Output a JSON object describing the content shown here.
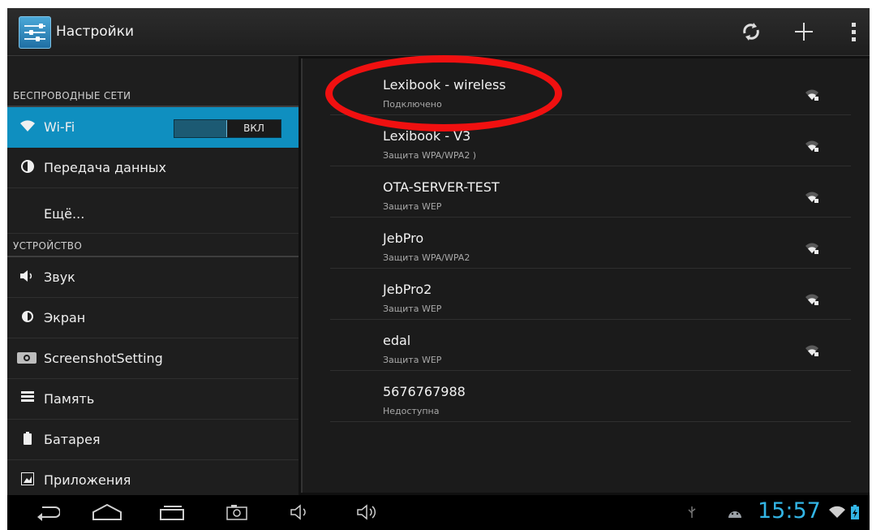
{
  "actionbar": {
    "title": "Настройки",
    "app_icon": "settings-sliders-icon",
    "sync_icon": "sync-icon",
    "add_icon": "plus-icon",
    "overflow_icon": "overflow-menu-icon"
  },
  "sidebar": {
    "section_wireless": "БЕСПРОВОДНЫЕ СЕТИ",
    "section_device": "УСТРОЙСТВО",
    "wifi": {
      "label": "Wi-Fi",
      "toggle_state": "ВКЛ",
      "icon": "wifi-icon"
    },
    "items": [
      {
        "label": "Передача данных",
        "icon": "data-usage-icon"
      },
      {
        "label": "Ещё...",
        "icon": ""
      },
      {
        "label": "Звук",
        "icon": "speaker-icon"
      },
      {
        "label": "Экран",
        "icon": "brightness-icon"
      },
      {
        "label": "ScreenshotSetting",
        "icon": "camera-icon"
      },
      {
        "label": "Память",
        "icon": "storage-icon"
      },
      {
        "label": "Батарея",
        "icon": "battery-icon"
      },
      {
        "label": "Приложения",
        "icon": "apps-icon"
      }
    ]
  },
  "networks": [
    {
      "ssid": "Lexibook - wireless",
      "status": "Подключено",
      "signal": true
    },
    {
      "ssid": "Lexibook - V3",
      "status": "Защита WPA/WPA2 )",
      "signal": true
    },
    {
      "ssid": "OTA-SERVER-TEST",
      "status": "Защита WEP",
      "signal": true
    },
    {
      "ssid": "JebPro",
      "status": "Защита WPA/WPA2",
      "signal": true
    },
    {
      "ssid": "JebPro2",
      "status": "Защита WEP",
      "signal": true
    },
    {
      "ssid": "edal",
      "status": "Защита WEP",
      "signal": true
    },
    {
      "ssid": "5676767988",
      "status": "Недоступна",
      "signal": false
    }
  ],
  "statusbar": {
    "time": "15:57",
    "accent": "#33b5e5",
    "icons": [
      "back-icon",
      "home-icon",
      "recent-apps-icon",
      "screenshot-icon",
      "volume-down-icon",
      "volume-up-icon",
      "usb-icon",
      "android-debug-icon",
      "wifi-status-icon",
      "battery-status-icon"
    ]
  },
  "colors": {
    "selected": "#0f8fc0",
    "highlight_ring": "#f01010"
  }
}
